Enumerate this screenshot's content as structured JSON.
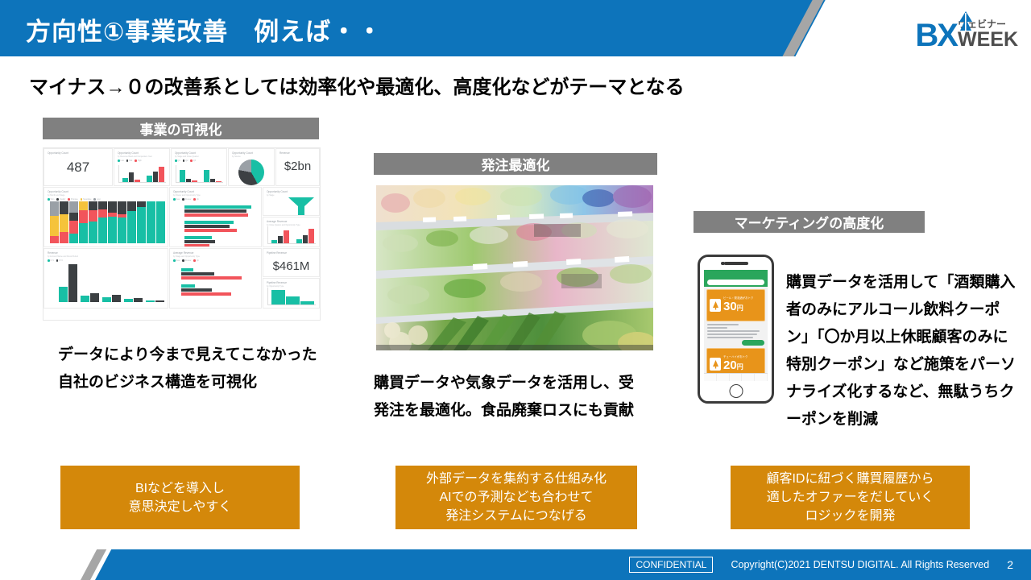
{
  "header": {
    "title": "方向性①事業改善　例えば・・",
    "bg_color": "#0d74bb",
    "logo": {
      "bx": "BX",
      "webinar": "ウェビナー",
      "week": "WEEK"
    }
  },
  "subtitle": "マイナス→０の改善系としては効率化や最適化、高度化などがテーマとなる",
  "columns": [
    {
      "banner": "事業の可視化",
      "caption": "データにより今まで見えてこなかった自社のビジネス構造を可視化",
      "action_lines": [
        "BIなどを導入し",
        "意思決定しやすく"
      ]
    },
    {
      "banner": "発注最適化",
      "caption": "購買データや気象データを活用し、受発注を最適化。食品廃棄ロスにも貢献",
      "action_lines": [
        "外部データを集約する仕組み化",
        "AIでの予測なども合わせて",
        "発注システムにつなげる"
      ]
    },
    {
      "banner": "マーケティングの高度化",
      "caption": "購買データを活用して「酒類購入者のみにアルコール飲料クーポン」「〇か月以上休眠顧客のみに特別クーポン」など施策をパーソナライズ化するなど、無駄うちクーポンを削減",
      "action_lines": [
        "顧客IDに紐づく購買履歴から",
        "適したオファーをだしていく",
        "ロジックを開発"
      ]
    }
  ],
  "dashboard": {
    "kpi_opportunity_count": "487",
    "kpi_revenue": "$2bn",
    "kpi_pipeline_revenue": "$461M"
  },
  "phone": {
    "coupon_top_amount": "30",
    "coupon_top_unit": "円",
    "coupon_bottom_amount": "20",
    "coupon_bottom_unit": "円"
  },
  "footer": {
    "confidential": "CONFIDENTIAL",
    "copyright": "Copyright(C)2021 DENTSU DIGITAL. All Rights Reserved",
    "page": "2",
    "bar_color": "#0d74bb"
  },
  "colors": {
    "accent_blue": "#0d74bb",
    "banner_gray": "#808080",
    "action_orange": "#d4880a"
  }
}
